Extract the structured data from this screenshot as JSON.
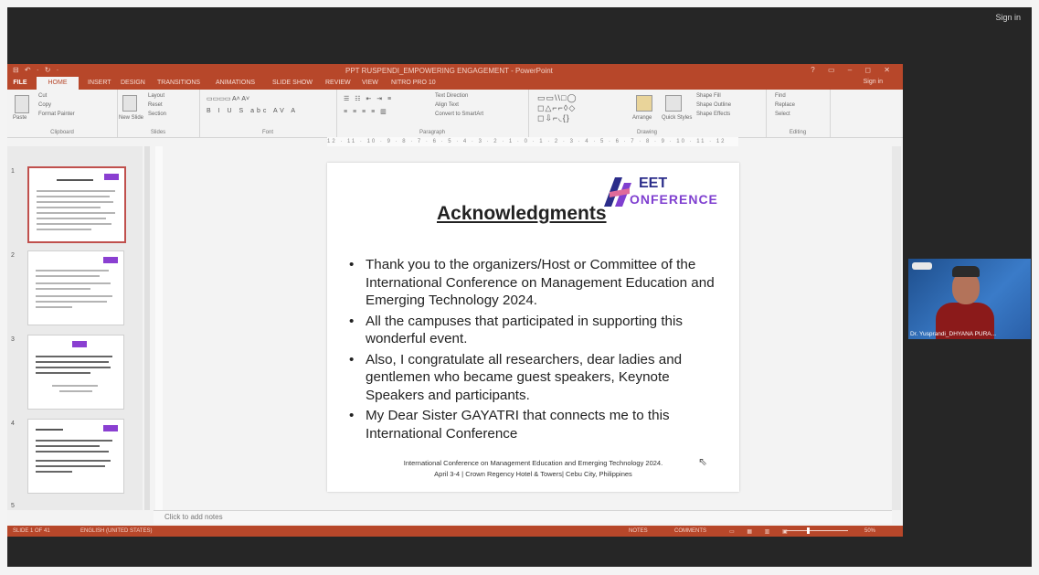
{
  "meeting": {
    "sign_in": "Sign in"
  },
  "window": {
    "title": "PPT RUSPENDI_EMPOWERING ENGAGEMENT - PowerPoint",
    "quick_access": "⊟ ↶ · ↻ ·",
    "controls": "? ▭ – ◻ ✕"
  },
  "ribbon": {
    "tabs": [
      "FILE",
      "HOME",
      "INSERT",
      "DESIGN",
      "TRANSITIONS",
      "ANIMATIONS",
      "SLIDE SHOW",
      "REVIEW",
      "VIEW",
      "NITRO PRO 10"
    ],
    "sign_in": "Sign in",
    "groups": [
      "Clipboard",
      "Slides",
      "Font",
      "Paragraph",
      "Drawing",
      "Editing"
    ],
    "clipboard": {
      "paste": "Paste",
      "cut": "Cut",
      "copy": "Copy",
      "format_painter": "Format Painter"
    },
    "slides": {
      "new_slide": "New Slide",
      "layout": "Layout",
      "reset": "Reset",
      "section": "Section"
    },
    "drawing": {
      "arrange": "Arrange",
      "quick_styles": "Quick Styles",
      "shape_fill": "Shape Fill",
      "shape_outline": "Shape Outline",
      "shape_effects": "Shape Effects"
    },
    "editing": {
      "find": "Find",
      "replace": "Replace",
      "select": "Select"
    },
    "paragraph": {
      "text_direction": "Text Direction",
      "align_text": "Align Text",
      "convert_smartart": "Convert to SmartArt"
    }
  },
  "ruler": "12 · 11 · 10 · 9 · 8 · 7 · 6 · 5 · 4 · 3 · 2 · 1 · 0 · 1 · 2 · 3 · 4 · 5 · 6 · 7 · 8 · 9 · 10 · 11 · 12",
  "thumbnails": [
    "1",
    "2",
    "3",
    "4",
    "5"
  ],
  "slide": {
    "logo_top": "EET",
    "logo_bottom": "ONFERENCE",
    "title": "Acknowledgments",
    "bullets": [
      "Thank you to the organizers/Host or  Committee of the International Conference on Management Education and Emerging Technology 2024.",
      "All the campuses that participated in supporting this wonderful event.",
      "Also, I congratulate all researchers, dear ladies and gentlemen who became guest speakers, Keynote Speakers and participants.",
      "My Dear Sister GAYATRI that connects me to this International Conference"
    ],
    "bullet_char": "•",
    "footer_line1": "International Conference on Management Education and Emerging Technology 2024.",
    "footer_line2": "April 3-4 | Crown Regency Hotel & Towers| Cebu City, Philippines"
  },
  "notes": {
    "placeholder": "Click to add notes"
  },
  "status": {
    "slide_info": "SLIDE 1 OF 41",
    "language": "ENGLISH (UNITED STATES)",
    "notes": "NOTES",
    "comments": "COMMENTS",
    "zoom": "50%"
  },
  "video": {
    "participant_name": "Dr. Yusprandi_DHYANA PURA..."
  },
  "colors": {
    "ppt_accent": "#b7472a",
    "meeting_bg": "#262626",
    "logo_purple": "#7f3fd0",
    "logo_navy": "#2b2d8a"
  }
}
